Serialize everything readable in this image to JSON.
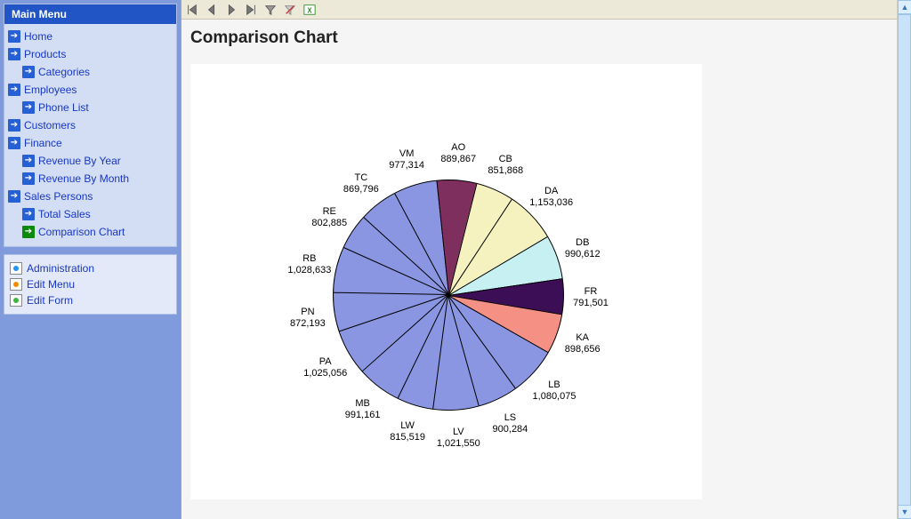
{
  "sidebar": {
    "header": "Main Menu",
    "items": [
      {
        "label": "Home",
        "sub": false
      },
      {
        "label": "Products",
        "sub": false
      },
      {
        "label": "Categories",
        "sub": true
      },
      {
        "label": "Employees",
        "sub": false
      },
      {
        "label": "Phone List",
        "sub": true
      },
      {
        "label": "Customers",
        "sub": false
      },
      {
        "label": "Finance",
        "sub": false
      },
      {
        "label": "Revenue By Year",
        "sub": true
      },
      {
        "label": "Revenue By Month",
        "sub": true
      },
      {
        "label": "Sales Persons",
        "sub": false
      },
      {
        "label": "Total Sales",
        "sub": true
      },
      {
        "label": "Comparison Chart",
        "sub": true,
        "active": true
      }
    ],
    "admin": [
      {
        "label": "Administration",
        "color": "#2196f3"
      },
      {
        "label": "Edit Menu",
        "color": "#f58b00"
      },
      {
        "label": "Edit Form",
        "color": "#3cb83c"
      }
    ]
  },
  "page": {
    "title": "Comparison Chart"
  },
  "chart_data": {
    "type": "pie",
    "title": "Comparison Chart",
    "slices": [
      {
        "label": "AO",
        "value": 889867,
        "color": "#7f2f5d"
      },
      {
        "label": "CB",
        "value": 851868,
        "color": "#f6f2c0"
      },
      {
        "label": "DA",
        "value": 1153036,
        "color": "#f6f2c0"
      },
      {
        "label": "DB",
        "value": 990612,
        "color": "#c6f0f2"
      },
      {
        "label": "FR",
        "value": 791501,
        "color": "#3b0e55"
      },
      {
        "label": "KA",
        "value": 898656,
        "color": "#f59184"
      },
      {
        "label": "LB",
        "value": 1080075,
        "color": "#8a96e2"
      },
      {
        "label": "LS",
        "value": 900284,
        "color": "#8a96e2"
      },
      {
        "label": "LV",
        "value": 1021550,
        "color": "#8a96e2"
      },
      {
        "label": "LW",
        "value": 815519,
        "color": "#8a96e2"
      },
      {
        "label": "MB",
        "value": 991161,
        "color": "#8a96e2"
      },
      {
        "label": "PA",
        "value": 1025056,
        "color": "#8a96e2"
      },
      {
        "label": "PN",
        "value": 872193,
        "color": "#8a96e2"
      },
      {
        "label": "RB",
        "value": 1028633,
        "color": "#8a96e2"
      },
      {
        "label": "RE",
        "value": 802885,
        "color": "#8a96e2"
      },
      {
        "label": "TC",
        "value": 869796,
        "color": "#8a96e2"
      },
      {
        "label": "VM",
        "value": 977314,
        "color": "#8a96e2"
      }
    ]
  },
  "toolbar": {
    "first": "First",
    "prev": "Previous",
    "next": "Next",
    "last": "Last",
    "filter": "Filter",
    "clear_filter": "Clear Filter",
    "excel": "Export"
  }
}
